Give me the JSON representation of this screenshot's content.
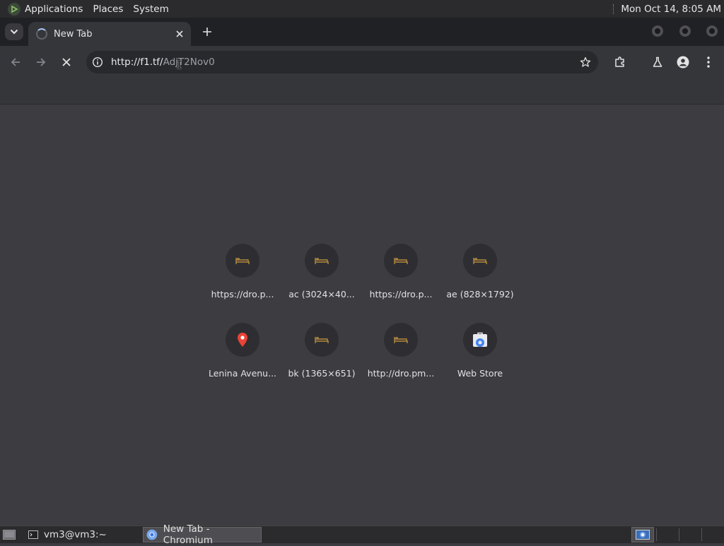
{
  "top_panel": {
    "menus": [
      "Applications",
      "Places",
      "System"
    ],
    "clock": "Mon Oct 14,  8:05 AM"
  },
  "browser": {
    "tab_title": "New Tab",
    "address": {
      "url_prefix": "http://f1.tf/",
      "url_rest": "AdjT2Nov0"
    }
  },
  "shortcuts": [
    {
      "label": "https://dro.p...",
      "icon": "dashboard-icon"
    },
    {
      "label": "ac (3024×40...",
      "icon": "dashboard-icon"
    },
    {
      "label": "https://dro.p...",
      "icon": "dashboard-icon"
    },
    {
      "label": "ae (828×1792)",
      "icon": "dashboard-icon"
    },
    {
      "label": "Lenina Avenu...",
      "icon": "map-pin-icon"
    },
    {
      "label": "bk (1365×651)",
      "icon": "dashboard-icon"
    },
    {
      "label": "http://dro.pm...",
      "icon": "dashboard-icon"
    },
    {
      "label": "Web Store",
      "icon": "web-store-icon"
    }
  ],
  "taskbar": {
    "items": [
      "vm3@vm3:~",
      "New Tab - Chromium"
    ]
  },
  "colors": {
    "dashboard_icon": "#b58a3c",
    "map_pin": "#ea4335",
    "web_store": "#4285f4"
  }
}
